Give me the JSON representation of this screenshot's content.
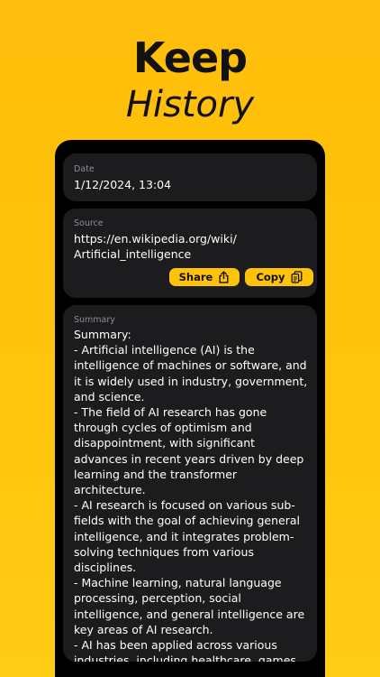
{
  "promo": {
    "headline_line1": "Keep",
    "headline_line2": "History"
  },
  "date": {
    "label": "Date",
    "value": "1/12/2024, 13:04"
  },
  "source": {
    "label": "Source",
    "url_line1": "https://en.wikipedia.org/wiki/",
    "url_line2": "Artificial_intelligence",
    "share_label": "Share",
    "copy_label": "Copy"
  },
  "summary": {
    "label": "Summary",
    "text": "Summary:\n- Artificial intelligence (AI) is the intelligence of machines or software, and it is widely used in industry, government, and science.\n- The field of AI research has gone through cycles of optimism and disappointment, with significant advances in recent years driven by deep learning and the transformer architecture.\n- AI research is focused on various sub-fields with the goal of achieving general intelligence, and it integrates problem-solving techniques from various disciplines.\n- Machine learning, natural language processing, perception, social intelligence, and general intelligence are key areas of AI research.\n- AI has been applied across various industries, including healthcare, games,"
  },
  "colors": {
    "accent": "#ffc20a",
    "card_bg": "#1c1c1e",
    "screen_bg": "#000000",
    "label_text": "#8e8e93"
  },
  "icons": {
    "share": "share-icon",
    "copy": "copy-icon"
  }
}
